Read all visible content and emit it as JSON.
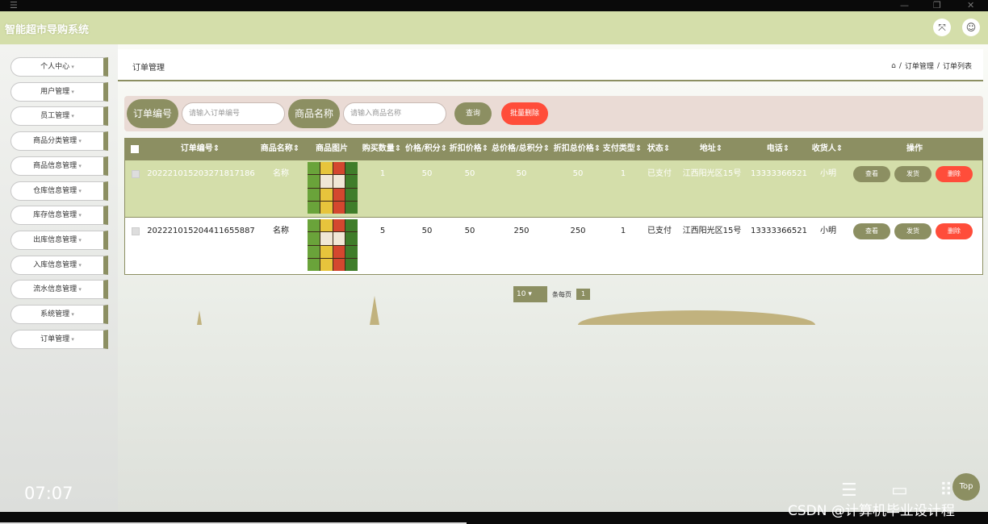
{
  "header": {
    "title": "智能超市导购系统",
    "expand_icon": "expand-icon",
    "user_icon": "user-icon"
  },
  "sidebar": {
    "items": [
      {
        "label": "个人中心"
      },
      {
        "label": "用户管理"
      },
      {
        "label": "员工管理"
      },
      {
        "label": "商品分类管理"
      },
      {
        "label": "商品信息管理"
      },
      {
        "label": "仓库信息管理"
      },
      {
        "label": "库存信息管理"
      },
      {
        "label": "出库信息管理"
      },
      {
        "label": "入库信息管理"
      },
      {
        "label": "流水信息管理"
      },
      {
        "label": "系统管理"
      },
      {
        "label": "订单管理"
      }
    ]
  },
  "page": {
    "title": "订单管理",
    "breadcrumb": [
      "订单管理",
      "订单列表"
    ]
  },
  "search": {
    "field1_label": "订单编号",
    "field1_placeholder": "请输入订单编号",
    "field2_label": "商品名称",
    "field2_placeholder": "请输入商品名称",
    "query_label": "查询",
    "batch_delete_label": "批量删除"
  },
  "table": {
    "headers": [
      "订单编号",
      "商品名称",
      "商品图片",
      "购买数量",
      "价格/积分",
      "折扣价格",
      "总价格/总积分",
      "折扣总价格",
      "支付类型",
      "状态",
      "地址",
      "电话",
      "收货人",
      "操作"
    ],
    "rows": [
      {
        "order_no": "20222101520327181718​6",
        "name": "名称",
        "qty": "1",
        "price": "50",
        "discount": "50",
        "total": "50",
        "discount_total": "50",
        "pay_type": "1",
        "status": "已支付",
        "address": "江西阳光区15号",
        "phone": "13333366521",
        "receiver": "小明"
      },
      {
        "order_no": "20222101520441165588​7",
        "name": "名称",
        "qty": "5",
        "price": "50",
        "discount": "50",
        "total": "250",
        "discount_total": "250",
        "pay_type": "1",
        "status": "已支付",
        "address": "江西阳光区15号",
        "phone": "13333366521",
        "receiver": "小明"
      }
    ],
    "actions": {
      "view": "查看",
      "ship": "发货",
      "delete": "删除"
    }
  },
  "pagination": {
    "page_size": "10",
    "per_page_label": "条每页",
    "current_page": "1"
  },
  "video_overlay": {
    "time": "07:07",
    "top_label": "Top",
    "watermark": "CSDN @计算机毕业设计程"
  },
  "colors": {
    "accent": "#8c8f62",
    "header_bg": "#d4deaa",
    "danger": "#ff4d3a",
    "search_bg": "#eadbd5"
  }
}
